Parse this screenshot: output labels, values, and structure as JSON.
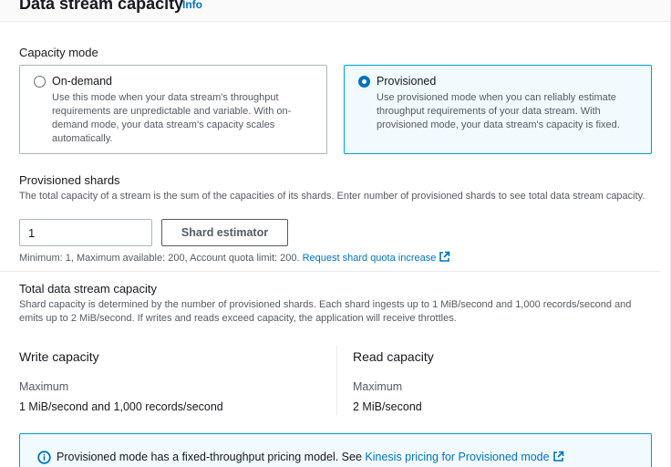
{
  "header": {
    "title": "Data stream capacity",
    "info_link": "Info"
  },
  "capacity_mode": {
    "label": "Capacity mode",
    "selected": "Provisioned",
    "options": [
      {
        "title": "On-demand",
        "description": "Use this mode when your data stream's throughput requirements are unpredictable and variable. With on-demand mode, your data stream's capacity scales automatically."
      },
      {
        "title": "Provisioned",
        "description": "Use provisioned mode when you can reliably estimate throughput requirements of your data stream. With provisioned mode, your data stream's capacity is fixed."
      }
    ]
  },
  "provisioned_shards": {
    "label": "Provisioned shards",
    "description": "The total capacity of a stream is the sum of the capacities of its shards. Enter number of provisioned shards to see total data stream capacity.",
    "value": "1",
    "estimator_button": "Shard estimator",
    "hint": "Minimum: 1, Maximum available: 200, Account quota limit: 200.",
    "quota_link": "Request shard quota increase"
  },
  "total_capacity": {
    "label": "Total data stream capacity",
    "description": "Shard capacity is determined by the number of provisioned shards. Each shard ingests up to 1 MiB/second and 1,000 records/second and emits up to 2 MiB/second. If writes and reads exceed capacity, the application will receive throttles.",
    "write": {
      "title": "Write capacity",
      "key": "Maximum",
      "value": "1 MiB/second and 1,000 records/second"
    },
    "read": {
      "title": "Read capacity",
      "key": "Maximum",
      "value": "2 MiB/second"
    }
  },
  "alert": {
    "text": "Provisioned mode has a fixed-throughput pricing model. See",
    "link": "Kinesis pricing for Provisioned mode"
  },
  "colors": {
    "link": "#0073bb",
    "selected_border": "#00a1c9",
    "selected_bg": "#f1faff"
  }
}
